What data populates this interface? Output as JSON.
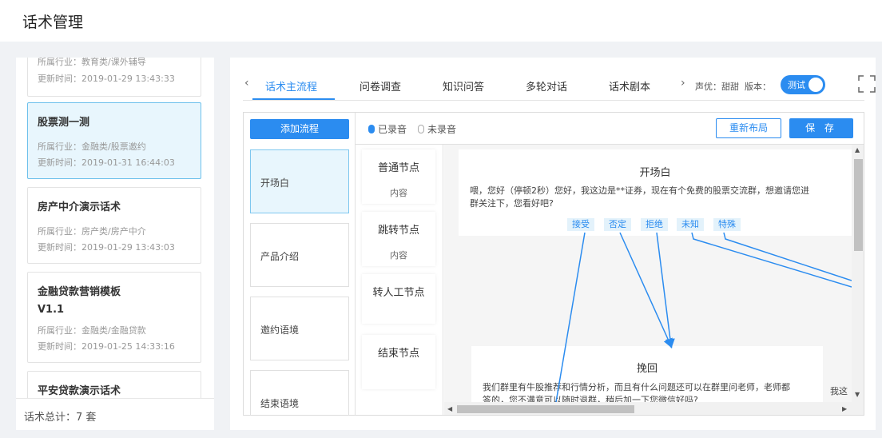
{
  "page": {
    "title": "话术管理"
  },
  "left": {
    "cards": [
      {
        "title": "",
        "industry": "所属行业：教育类/课外辅导",
        "updated": "更新时间：2019-01-29 13:43:33",
        "active": false
      },
      {
        "title": "股票测一测",
        "industry": "所属行业：金融类/股票邀约",
        "updated": "更新时间：2019-01-31 16:44:03",
        "active": true
      },
      {
        "title": "房产中介演示话术",
        "industry": "所属行业：房产类/房产中介",
        "updated": "更新时间：2019-01-29 13:43:03",
        "active": false
      },
      {
        "title": "金融贷款营销模板V1.1",
        "industry": "所属行业：金融类/金融贷款",
        "updated": "更新时间：2019-01-25 14:33:16",
        "active": false
      },
      {
        "title": "平安贷款演示话术",
        "industry": "",
        "updated": "",
        "active": false
      }
    ],
    "total": "话术总计：7 套"
  },
  "tabs": {
    "items": [
      "话术主流程",
      "问卷调查",
      "知识问答",
      "多轮对话",
      "话术剧本"
    ],
    "active_index": 0,
    "voice_label": "声优：甜甜",
    "version_label": "版本：",
    "toggle_label": "测试",
    "toggle_on": true
  },
  "editor": {
    "add_flow": "添加流程",
    "flows": [
      "开场白",
      "产品介绍",
      "邀约语境",
      "结束语境"
    ],
    "active_flow": 0,
    "recorded": "已录音",
    "not_recorded": "未录音",
    "relayout": "重新布局",
    "save": "保 存",
    "node_types": [
      {
        "name": "普通节点",
        "sub": "内容"
      },
      {
        "name": "跳转节点",
        "sub": "内容"
      },
      {
        "name": "转人工节点",
        "sub": ""
      },
      {
        "name": "结束节点",
        "sub": ""
      }
    ],
    "canvas": {
      "opening": {
        "title": "开场白",
        "text1": "喂，您好（停顿2秒）您好，我这边是**证券，现在有个免费的股票交流群，想邀请您进",
        "text2": "群关注下，您看好吧?",
        "branches": [
          "接受",
          "否定",
          "拒绝",
          "未知",
          "特殊"
        ]
      },
      "retain": {
        "title": "挽回",
        "text1": "我们群里有牛股推荐和行情分析，而且有什么问题还可以在群里问老师，老师都",
        "text2": "答的，您不满意可以随时退群，稍后加一下您微信好吗?",
        "clipped": "我这"
      }
    }
  },
  "colors": {
    "accent": "#2b8cf0",
    "active_bg": "#e8f6fd",
    "edge": "#2b8cf0"
  },
  "icons": [
    "chevron-left-icon",
    "chevron-right-icon",
    "fullscreen-icon",
    "mic-icon"
  ]
}
